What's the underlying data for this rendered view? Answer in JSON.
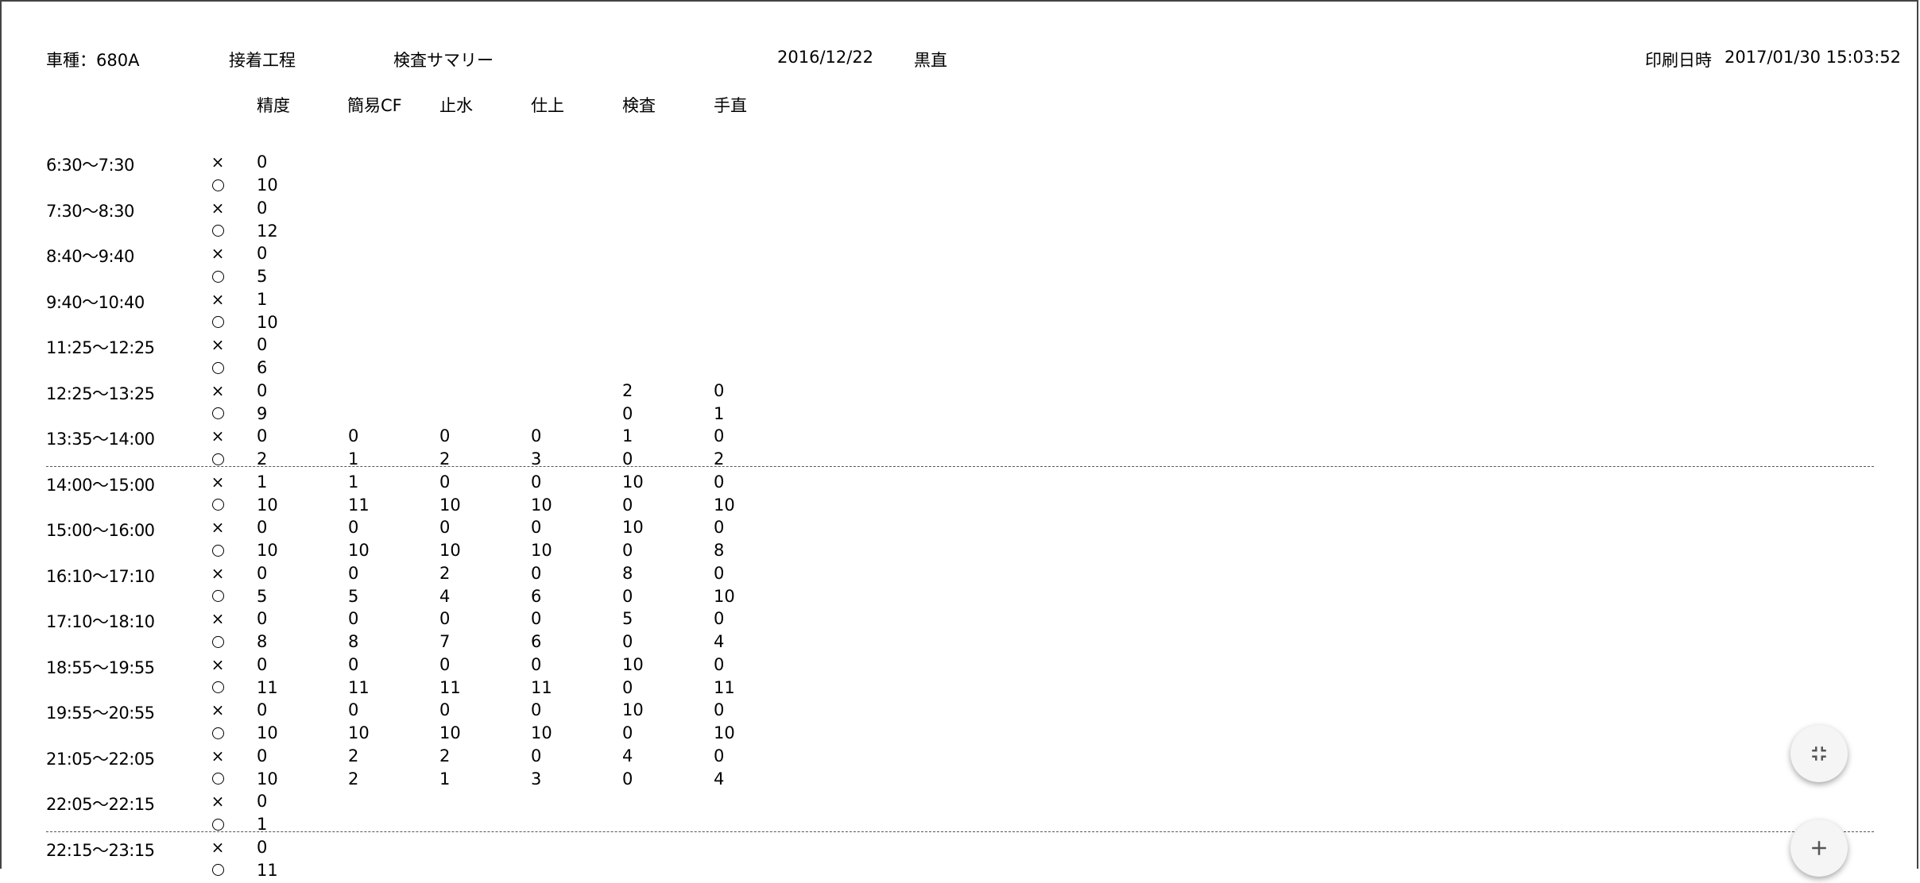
{
  "header": {
    "model": "車種：680A",
    "process": "接着工程",
    "report": "検査サマリー",
    "date": "2016/12/22",
    "operator": "黒直",
    "print_label": "印刷日時",
    "print_datetime": "2017/01/30 15:03:52"
  },
  "columns": [
    "精度",
    "簡易CF",
    "止水",
    "仕上",
    "検査",
    "手直"
  ],
  "marks": {
    "ng": "×",
    "ok": "○"
  },
  "rows": [
    {
      "time": "6:30〜7:30",
      "ng": [
        "0",
        "",
        "",
        "",
        "",
        ""
      ],
      "ok": [
        "10",
        "",
        "",
        "",
        "",
        ""
      ]
    },
    {
      "time": "7:30〜8:30",
      "ng": [
        "0",
        "",
        "",
        "",
        "",
        ""
      ],
      "ok": [
        "12",
        "",
        "",
        "",
        "",
        ""
      ]
    },
    {
      "time": "8:40〜9:40",
      "ng": [
        "0",
        "",
        "",
        "",
        "",
        ""
      ],
      "ok": [
        "5",
        "",
        "",
        "",
        "",
        ""
      ]
    },
    {
      "time": "9:40〜10:40",
      "ng": [
        "1",
        "",
        "",
        "",
        "",
        ""
      ],
      "ok": [
        "10",
        "",
        "",
        "",
        "",
        ""
      ]
    },
    {
      "time": "11:25〜12:25",
      "ng": [
        "0",
        "",
        "",
        "",
        "",
        ""
      ],
      "ok": [
        "6",
        "",
        "",
        "",
        "",
        ""
      ]
    },
    {
      "time": "12:25〜13:25",
      "ng": [
        "0",
        "",
        "",
        "",
        "2",
        "0"
      ],
      "ok": [
        "9",
        "",
        "",
        "",
        "0",
        "1"
      ]
    },
    {
      "time": "13:35〜14:00",
      "ng": [
        "0",
        "0",
        "0",
        "0",
        "1",
        "0"
      ],
      "ok": [
        "2",
        "1",
        "2",
        "3",
        "0",
        "2"
      ]
    },
    {
      "time": "14:00〜15:00",
      "ng": [
        "1",
        "1",
        "0",
        "0",
        "10",
        "0"
      ],
      "ok": [
        "10",
        "11",
        "10",
        "10",
        "0",
        "10"
      ]
    },
    {
      "time": "15:00〜16:00",
      "ng": [
        "0",
        "0",
        "0",
        "0",
        "10",
        "0"
      ],
      "ok": [
        "10",
        "10",
        "10",
        "10",
        "0",
        "8"
      ]
    },
    {
      "time": "16:10〜17:10",
      "ng": [
        "0",
        "0",
        "2",
        "0",
        "8",
        "0"
      ],
      "ok": [
        "5",
        "5",
        "4",
        "6",
        "0",
        "10"
      ]
    },
    {
      "time": "17:10〜18:10",
      "ng": [
        "0",
        "0",
        "0",
        "0",
        "5",
        "0"
      ],
      "ok": [
        "8",
        "8",
        "7",
        "6",
        "0",
        "4"
      ]
    },
    {
      "time": "18:55〜19:55",
      "ng": [
        "0",
        "0",
        "0",
        "0",
        "10",
        "0"
      ],
      "ok": [
        "11",
        "11",
        "11",
        "11",
        "0",
        "11"
      ]
    },
    {
      "time": "19:55〜20:55",
      "ng": [
        "0",
        "0",
        "0",
        "0",
        "10",
        "0"
      ],
      "ok": [
        "10",
        "10",
        "10",
        "10",
        "0",
        "10"
      ]
    },
    {
      "time": "21:05〜22:05",
      "ng": [
        "0",
        "2",
        "2",
        "0",
        "4",
        "0"
      ],
      "ok": [
        "10",
        "2",
        "1",
        "3",
        "0",
        "4"
      ]
    },
    {
      "time": "22:05〜22:15",
      "ng": [
        "0",
        "",
        "",
        "",
        "",
        ""
      ],
      "ok": [
        "1",
        "",
        "",
        "",
        "",
        ""
      ]
    },
    {
      "time": "22:15〜23:15",
      "ng": [
        "0",
        "",
        "",
        "",
        "",
        ""
      ],
      "ok": [
        "11",
        "",
        "",
        "",
        "",
        ""
      ]
    }
  ],
  "separators_after_row": [
    6,
    14
  ],
  "buttons": {
    "collapse_icon": "collapse-icon",
    "add_icon": "plus-icon"
  }
}
